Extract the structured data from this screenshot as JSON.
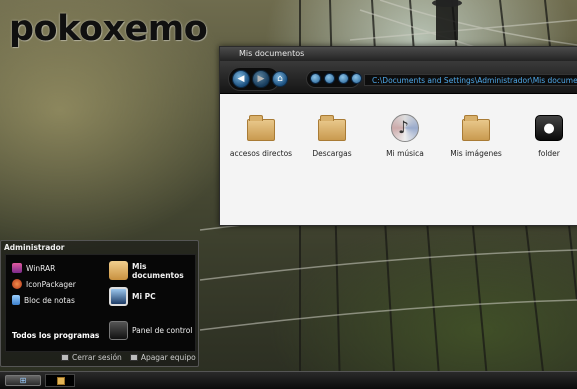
{
  "desktop": {
    "logo_text": "pokoxemo"
  },
  "explorer": {
    "title": "Mis documentos",
    "address": "C:\\Documents and Settings\\Administrador\\Mis documentos",
    "items": [
      {
        "label": "accesos directos",
        "icon": "folder-icon"
      },
      {
        "label": "Descargas",
        "icon": "folder-icon"
      },
      {
        "label": "Mi música",
        "icon": "music-cd-icon"
      },
      {
        "label": "Mis imágenes",
        "icon": "pictures-folder-icon"
      },
      {
        "label": "folder",
        "icon": "apple-folder-icon"
      }
    ]
  },
  "start_menu": {
    "user": "Administrador",
    "programs": [
      {
        "label": "WinRAR",
        "icon": "winrar-icon",
        "color": "#c03a8c"
      },
      {
        "label": "IconPackager",
        "icon": "iconpackager-icon",
        "color": "#d9572a"
      },
      {
        "label": "Bloc de notas",
        "icon": "notepad-icon",
        "color": "#5aa0e0"
      }
    ],
    "all_programs": "Todos los programas",
    "places": [
      {
        "label": "Mis documentos",
        "icon": "my-documents-icon"
      },
      {
        "label": "Mi PC",
        "icon": "my-computer-icon"
      },
      {
        "label": "Panel de control",
        "icon": "control-panel-icon"
      }
    ],
    "logoff": "Cerrar sesión",
    "shutdown": "Apagar equipo"
  },
  "colors": {
    "address_text": "#4fa8e8",
    "window_bg": "#f4f4f4"
  }
}
